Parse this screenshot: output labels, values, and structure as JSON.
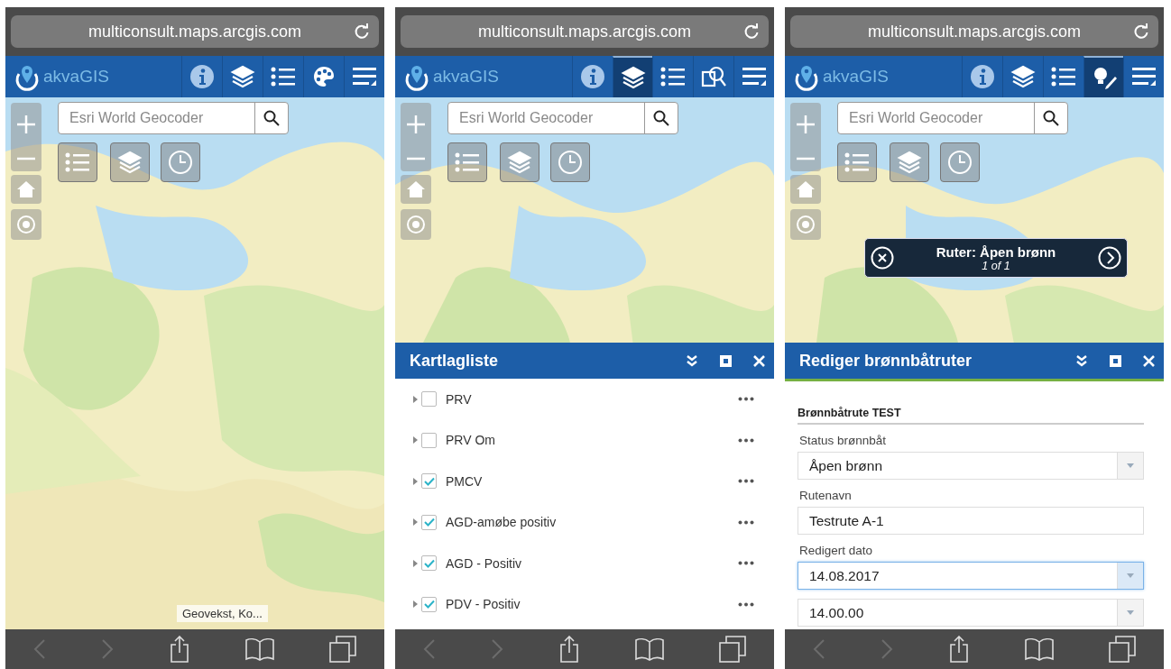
{
  "phones": [
    {
      "url": "multiconsult.maps.arcgis.com",
      "app_name": "akvaGIS",
      "header_tools": [
        {
          "kind": "info",
          "selected": false
        },
        {
          "kind": "layers",
          "selected": false
        },
        {
          "kind": "legend",
          "selected": false
        },
        {
          "kind": "palette",
          "selected": false
        },
        {
          "kind": "menu",
          "selected": false
        }
      ],
      "search": {
        "placeholder": "Esri World Geocoder"
      },
      "attribution": "Geovekst, Ko..."
    },
    {
      "url": "multiconsult.maps.arcgis.com",
      "app_name": "akvaGIS",
      "header_tools": [
        {
          "kind": "info",
          "selected": false
        },
        {
          "kind": "layers",
          "selected": true
        },
        {
          "kind": "legend",
          "selected": false
        },
        {
          "kind": "search_doc",
          "selected": false
        },
        {
          "kind": "menu",
          "selected": false
        }
      ],
      "search": {
        "placeholder": "Esri World Geocoder"
      },
      "panel": {
        "kind": "layer_list",
        "title": "Kartlagliste",
        "layers": [
          {
            "name": "PRV",
            "checked": false
          },
          {
            "name": "PRV Om",
            "checked": false
          },
          {
            "name": "PMCV",
            "checked": true
          },
          {
            "name": "AGD-amøbe positiv",
            "checked": true
          },
          {
            "name": "AGD - Positiv",
            "checked": true
          },
          {
            "name": "PDV - Positiv",
            "checked": true
          }
        ]
      }
    },
    {
      "url": "multiconsult.maps.arcgis.com",
      "app_name": "akvaGIS",
      "header_tools": [
        {
          "kind": "info",
          "selected": false
        },
        {
          "kind": "layers",
          "selected": false
        },
        {
          "kind": "legend",
          "selected": false
        },
        {
          "kind": "edit",
          "selected": true
        },
        {
          "kind": "menu",
          "selected": false
        }
      ],
      "search": {
        "placeholder": "Esri World Geocoder"
      },
      "popup": {
        "title": "Ruter: Åpen brønn",
        "count": "1 of 1"
      },
      "panel": {
        "kind": "edit_form",
        "title": "Rediger brønnbåtruter",
        "form_title": "Brønnbåtrute TEST",
        "fields": [
          {
            "kind": "select",
            "label": "Status brønnbåt",
            "value": "Åpen brønn",
            "focused": false
          },
          {
            "kind": "text",
            "label": "Rutenavn",
            "value": "Testrute A-1",
            "focused": false
          },
          {
            "kind": "select",
            "label": "Redigert dato",
            "value": "14.08.2017",
            "focused": true
          },
          {
            "kind": "select",
            "value": "14.00.00",
            "focused": false
          }
        ]
      }
    }
  ]
}
